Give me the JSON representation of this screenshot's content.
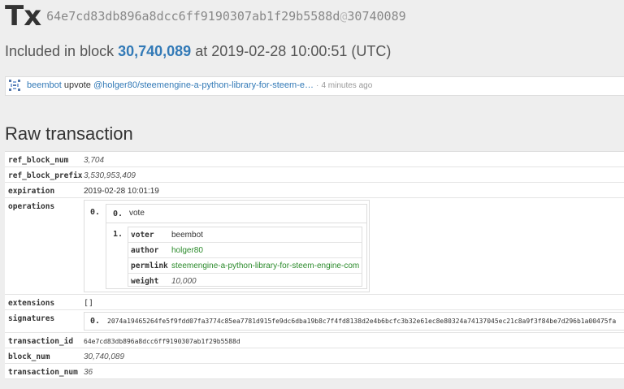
{
  "header": {
    "tx_label": "Tx",
    "tx_hash": "64e7cd83db896a8dcc6ff9190307ab1f29b5588d",
    "at_sign": "@",
    "tx_block": "30740089"
  },
  "included": {
    "prefix": "Included in block",
    "block": "30,740,089",
    "suffix": "at 2019-02-28 10:00:51 (UTC)"
  },
  "op_summary": {
    "voter": "beembot",
    "action": "upvote",
    "target": "@holger80/steemengine-a-python-library-for-steem-e…",
    "dot": "·",
    "time_ago": "4 minutes ago"
  },
  "raw": {
    "title": "Raw transaction",
    "rows": {
      "ref_block_num": {
        "key": "ref_block_num",
        "value": "3,704"
      },
      "ref_block_prefix": {
        "key": "ref_block_prefix",
        "value": "3,530,953,409"
      },
      "expiration": {
        "key": "expiration",
        "value": "2019-02-28 10:01:19"
      },
      "operations": {
        "key": "operations"
      },
      "extensions": {
        "key": "extensions",
        "value": "[]"
      },
      "signatures": {
        "key": "signatures"
      },
      "transaction_id": {
        "key": "transaction_id",
        "value": "64e7cd83db896a8dcc6ff9190307ab1f29b5588d"
      },
      "block_num": {
        "key": "block_num",
        "value": "30,740,089"
      },
      "transaction_num": {
        "key": "transaction_num",
        "value": "36"
      }
    },
    "operation": {
      "outer_index": "0.",
      "op_index": "0.",
      "op_type": "vote",
      "body_index": "1.",
      "fields": {
        "voter": {
          "key": "voter",
          "value": "beembot"
        },
        "author": {
          "key": "author",
          "value": "holger80"
        },
        "permlink": {
          "key": "permlink",
          "value": "steemengine-a-python-library-for-steem-engine-com"
        },
        "weight": {
          "key": "weight",
          "value": "10,000"
        }
      }
    },
    "signature": {
      "index": "0.",
      "value": "2074a19465264fe5f9fdd07fa3774c85ea7781d915fe9dc6dba19b8c7f4fd8138d2e4b6bcfc3b32e61ec8e80324a74137045ec21c8a9f3f84be7d296b1a00475fa"
    }
  }
}
